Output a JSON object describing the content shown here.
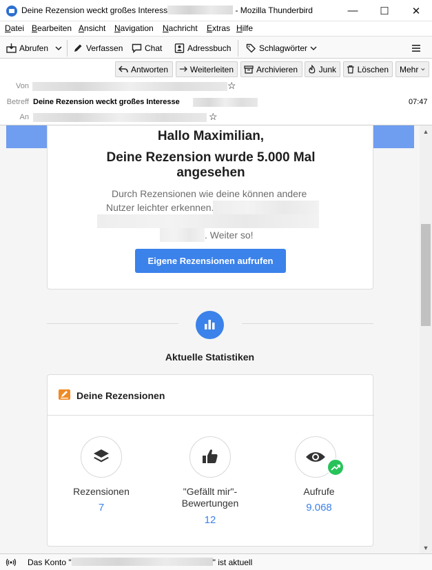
{
  "window": {
    "title_prefix": "Deine Rezension weckt großes Interess",
    "title_suffix": "- Mozilla Thunderbird",
    "minimize": "—",
    "maximize": "☐",
    "close": "✕"
  },
  "menubar": {
    "items": [
      {
        "u": "D",
        "rest": "atei"
      },
      {
        "u": "B",
        "rest": "earbeiten"
      },
      {
        "u": "A",
        "rest": "nsicht"
      },
      {
        "u": "N",
        "rest": "avigation"
      },
      {
        "u": "N",
        "rest": "achricht"
      },
      {
        "u": "E",
        "rest": "xtras"
      },
      {
        "u": "H",
        "rest": "ilfe"
      }
    ]
  },
  "toolbar": {
    "abrufen": "Abrufen",
    "verfassen": "Verfassen",
    "chat": "Chat",
    "adressbuch": "Adressbuch",
    "schlagwoerter": "Schlagwörter",
    "menu_icon": "hamburger-menu-icon"
  },
  "message_header": {
    "buttons": {
      "reply": "Antworten",
      "forward": "Weiterleiten",
      "archive": "Archivieren",
      "junk": "Junk",
      "delete": "Löschen",
      "more": "Mehr"
    },
    "from_label": "Von",
    "subject_label": "Betreff",
    "subject": "Deine Rezension weckt großes Interesse",
    "time": "07:47",
    "to_label": "An"
  },
  "email": {
    "greeting": "Hallo Maximilian,",
    "headline": "Deine Rezension wurde 5.000 Mal angesehen",
    "body_line1": "Durch Rezensionen wie deine können andere",
    "body_line2": "Nutzer leichter erkennen.",
    "body_end": ". Weiter so!",
    "cta": "Eigene Rezensionen aufrufen",
    "stats_heading": "Aktuelle Statistiken",
    "reviews_card_title": "Deine Rezensionen",
    "stats": [
      {
        "label": "Rezensionen",
        "value": "7",
        "icon": "layers-icon"
      },
      {
        "label": "\"Gefällt mir\"-Bewertungen",
        "value": "12",
        "icon": "thumbs-up-icon"
      },
      {
        "label": "Aufrufe",
        "value": "9.068",
        "icon": "eye-icon"
      }
    ],
    "accent_color": "#3b82ea",
    "trend_color": "#27c35a"
  },
  "statusbar": {
    "prefix": "Das Konto \"",
    "suffix": "\" ist aktuell"
  }
}
